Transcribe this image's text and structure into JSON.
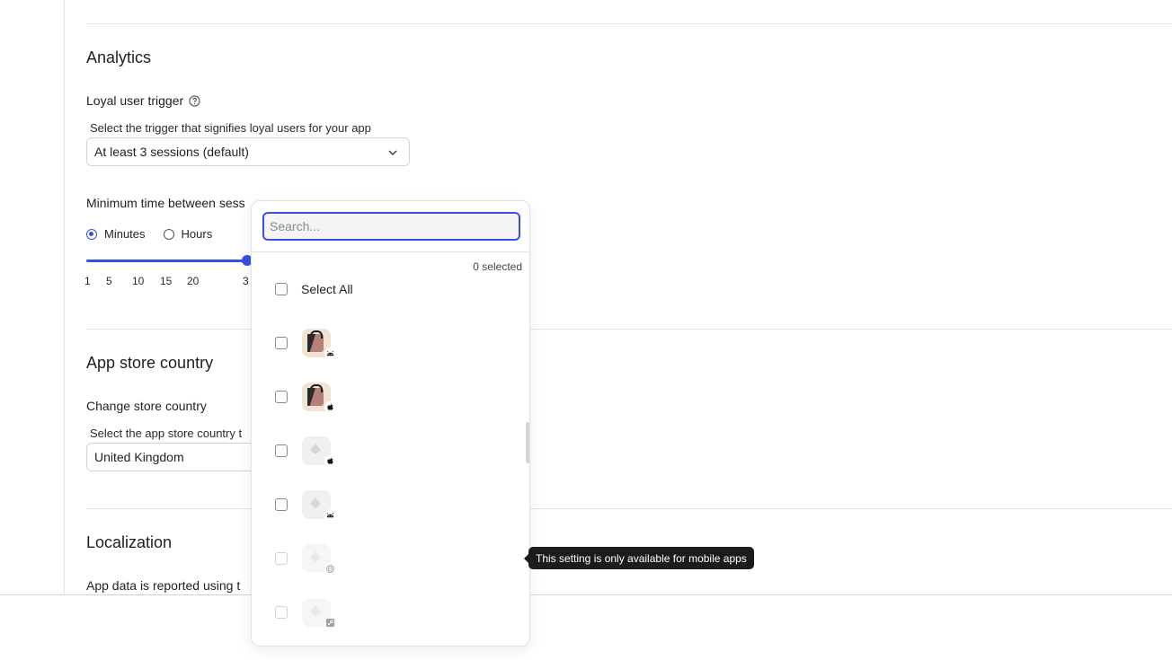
{
  "sections": {
    "analytics": {
      "title": "Analytics",
      "loyal_trigger": {
        "label": "Loyal user trigger",
        "help": "Select the trigger that signifies loyal users for your app",
        "value": "At least 3 sessions (default)"
      },
      "min_time": {
        "label": "Minimum time between sess",
        "units": {
          "minutes": "Minutes",
          "hours": "Hours",
          "selected": "Minutes"
        },
        "ticks": [
          "1",
          "5",
          "10",
          "15",
          "20",
          "3"
        ],
        "slider_value": 30
      }
    },
    "app_store": {
      "title": "App store country",
      "change_label": "Change store country",
      "help": "Select the app store country t",
      "value": "United Kingdom"
    },
    "localization": {
      "title": "Localization",
      "reported_label": "App data is reported using t"
    }
  },
  "dropdown": {
    "search_placeholder": "Search...",
    "selected_count": "0 selected",
    "select_all": "Select All",
    "options": [
      {
        "icon": "shopping-bag-app-icon",
        "platform": "android-icon",
        "disabled": false
      },
      {
        "icon": "shopping-bag-app-icon",
        "platform": "apple-icon",
        "disabled": false
      },
      {
        "icon": "placeholder-app-icon",
        "platform": "apple-icon",
        "disabled": false
      },
      {
        "icon": "placeholder-app-icon",
        "platform": "android-icon",
        "disabled": false
      },
      {
        "icon": "placeholder-app-icon",
        "platform": "globe-icon",
        "disabled": true
      },
      {
        "icon": "placeholder-app-icon",
        "platform": "steam-icon",
        "disabled": true
      }
    ]
  },
  "tooltip": "This setting is only available for mobile apps",
  "colors": {
    "accent": "#3b4fe0",
    "tooltip_bg": "#1c1c1c"
  }
}
